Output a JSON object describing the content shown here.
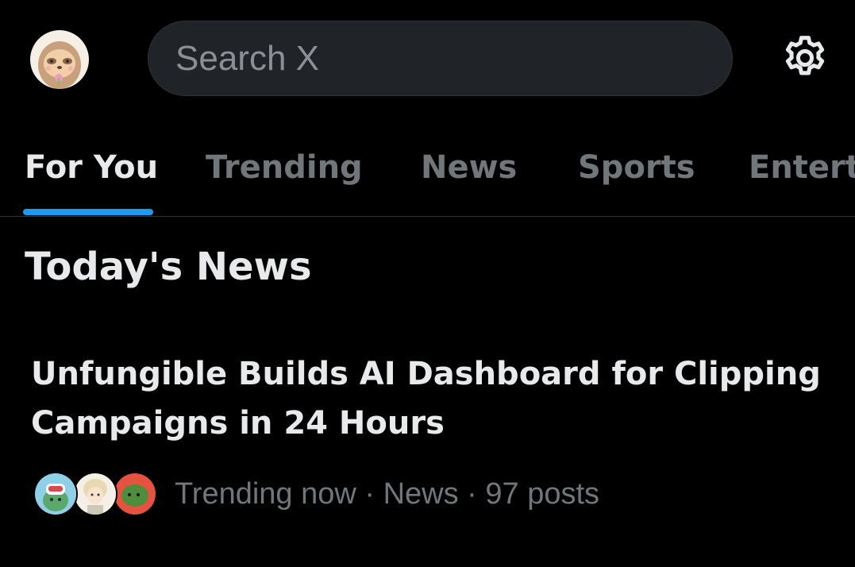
{
  "header": {
    "search_placeholder": "Search X",
    "avatar_icon": "sloth-avatar-icon",
    "settings_icon": "gear-icon"
  },
  "tabs": [
    {
      "label": "For You",
      "active": true
    },
    {
      "label": "Trending",
      "active": false
    },
    {
      "label": "News",
      "active": false
    },
    {
      "label": "Sports",
      "active": false
    },
    {
      "label": "Entert",
      "active": false
    }
  ],
  "section": {
    "title": "Today's News"
  },
  "news": {
    "headline": "Unfungible Builds AI Dashboard for Clipping Campaigns in 24 Hours",
    "meta": "Trending now · News · 97 posts",
    "avatars": [
      "robot-avatar-icon",
      "anime-character-avatar-icon",
      "frog-avatar-icon"
    ]
  },
  "colors": {
    "background": "#000000",
    "accent": "#1d9bf0",
    "text_primary": "#e7e9ea",
    "text_secondary": "#71767b",
    "search_bg": "#202327"
  }
}
